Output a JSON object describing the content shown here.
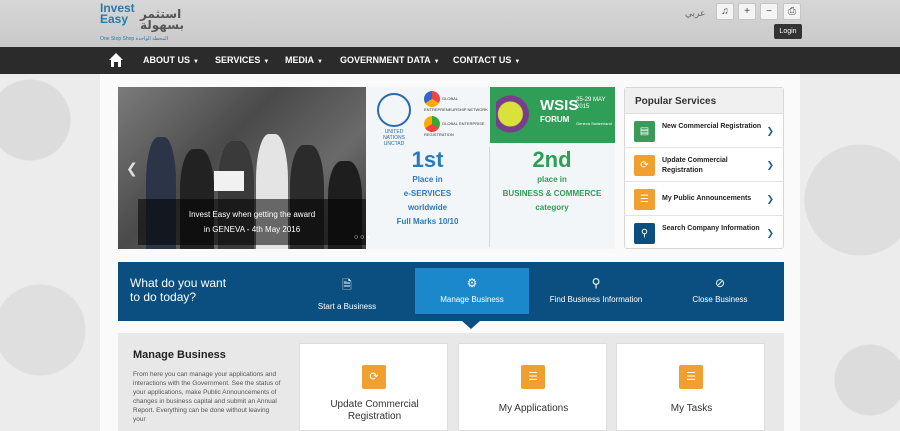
{
  "header": {
    "logo_en": "Invest Easy",
    "logo_ar": "استثمر بسهولة",
    "logo_tagline": "One Stop Shop  المحطة الواحدة",
    "lang_label": "عربي",
    "login_tooltip": "Login"
  },
  "nav": {
    "items": [
      {
        "label": "ABOUT US"
      },
      {
        "label": "SERVICES"
      },
      {
        "label": "MEDIA"
      },
      {
        "label": "GOVERNMENT DATA"
      },
      {
        "label": "CONTACT US"
      }
    ]
  },
  "slider": {
    "caption_line1": "Invest Easy when getting the award",
    "caption_line2": "in GENEVA - 4th May 2016"
  },
  "award": {
    "unctad_label": "UNITED NATIONS UNCTAD",
    "gen_label": "GLOBAL ENTREPRENEURSHIP NETWORK",
    "ger_label": "GLOBAL ENTERPRISE REGISTRATION",
    "wsis_title": "WSIS",
    "wsis_sub": "FORUM",
    "wsis_dates": "25-29 MAY 2015",
    "wsis_place": "Geneva Switzerland",
    "left_rank": "1st",
    "left_line1": "Place in",
    "left_line2": "e-SERVICES",
    "left_line3": "worldwide",
    "left_line4": "Full Marks 10/10",
    "right_rank": "2nd",
    "right_line1": "place in",
    "right_line2": "BUSINESS & COMMERCE",
    "right_line3": "category"
  },
  "popular": {
    "title": "Popular Services",
    "items": [
      {
        "label": "New Commercial Registration",
        "color": "#3a9a5a",
        "icon": "document-icon"
      },
      {
        "label": "Update Commercial Registration",
        "color": "#f0a030",
        "icon": "refresh-icon"
      },
      {
        "label": "My Public Announcements",
        "color": "#f0a030",
        "icon": "list-icon"
      },
      {
        "label": "Search Company Information",
        "color": "#0b4f80",
        "icon": "search-icon"
      }
    ]
  },
  "todo": {
    "question_line1": "What do you want",
    "question_line2": "to do today?",
    "tabs": [
      {
        "label": "Start a Business",
        "icon": "file-icon"
      },
      {
        "label": "Manage Business",
        "icon": "gear-icon"
      },
      {
        "label": "Find Business Information",
        "icon": "search-icon"
      },
      {
        "label": "Close Business",
        "icon": "ban-icon"
      }
    ],
    "active_tab": "Manage Business"
  },
  "manage": {
    "title": "Manage Business",
    "description": "From here you can manage your applications and interactions with the Government. See the status of your applications, make Public Announcements of changes in business capital and submit an Annual Report. Everything can be done without leaving your",
    "cards": [
      {
        "label": "Update Commercial Registration",
        "icon": "refresh-icon"
      },
      {
        "label": "My Applications",
        "icon": "list-icon"
      },
      {
        "label": "My Tasks",
        "icon": "list-icon"
      }
    ]
  },
  "colors": {
    "navbar": "#2b2b2b",
    "todo_bar": "#0b4f80",
    "todo_active": "#1b88cc",
    "accent_orange": "#f0a030",
    "wsis_green": "#2f9e57"
  }
}
